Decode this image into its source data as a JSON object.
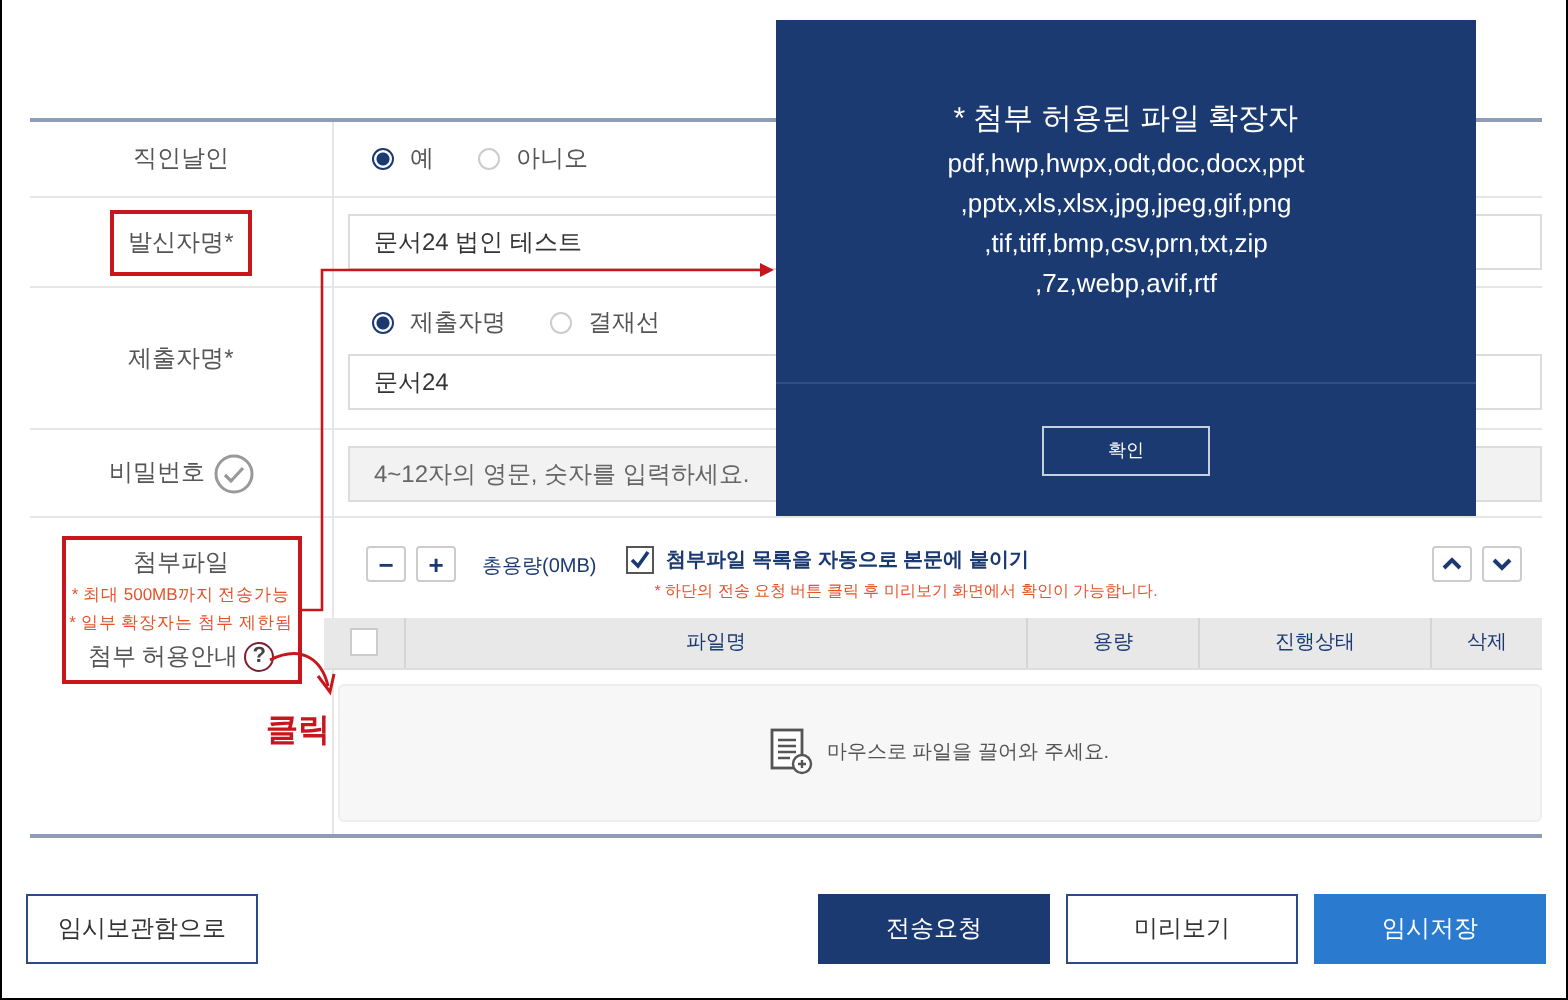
{
  "form": {
    "rows": [
      {
        "kind": "radio",
        "label": "직인날인",
        "annotated": false,
        "options": [
          {
            "label": "예",
            "selected": true
          },
          {
            "label": "아니오",
            "selected": false
          }
        ]
      },
      {
        "kind": "text",
        "label": "발신자명*",
        "annotated": true,
        "value": "문서24 법인 테스트"
      },
      {
        "kind": "radio_text",
        "label": "제출자명*",
        "annotated": false,
        "options": [
          {
            "label": "제출자명",
            "selected": true
          },
          {
            "label": "결재선",
            "selected": false
          }
        ],
        "value": "문서24"
      },
      {
        "kind": "password",
        "label": "비밀번호",
        "annotated": false,
        "placeholder": "4~12자의 영문, 숫자를 입력하세요."
      }
    ]
  },
  "attachment": {
    "label": "첨부파일",
    "annotated": true,
    "notes": [
      "* 최대 500MB까지 전송가능",
      "* 일부 확장자는 첨부 제한됨"
    ],
    "guide": "첨부 허용안내",
    "guide_glyph": "?",
    "minus": "−",
    "plus": "+",
    "total": "총용량(0MB)",
    "auto_attach": {
      "label": "첨부파일 목록을 자동으로 본문에 붙이기",
      "checked": true
    },
    "hint": "* 하단의 전송 요청 버튼 클릭 후 미리보기 화면에서 확인이 가능합니다.",
    "select_all": false,
    "columns": [
      "파일명",
      "용량",
      "진행상태",
      "삭제"
    ],
    "drop_hint": "마우스로 파일을 끌어와 주세요."
  },
  "callout": "클릭",
  "modal": {
    "title": "* 첨부 허용된 파일 확장자",
    "lines": [
      "pdf,hwp,hwpx,odt,doc,docx,ppt",
      ",pptx,xls,xlsx,jpg,jpeg,gif,png",
      ",tif,tiff,bmp,csv,prn,txt,zip",
      ",7z,webp,avif,rtf"
    ],
    "button": "확인"
  },
  "footer": {
    "left": "임시보관함으로",
    "buttons": [
      {
        "label": "전송요청",
        "kind": "primary"
      },
      {
        "label": "미리보기",
        "kind": "outline"
      },
      {
        "label": "임시저장",
        "kind": "accent"
      }
    ]
  }
}
